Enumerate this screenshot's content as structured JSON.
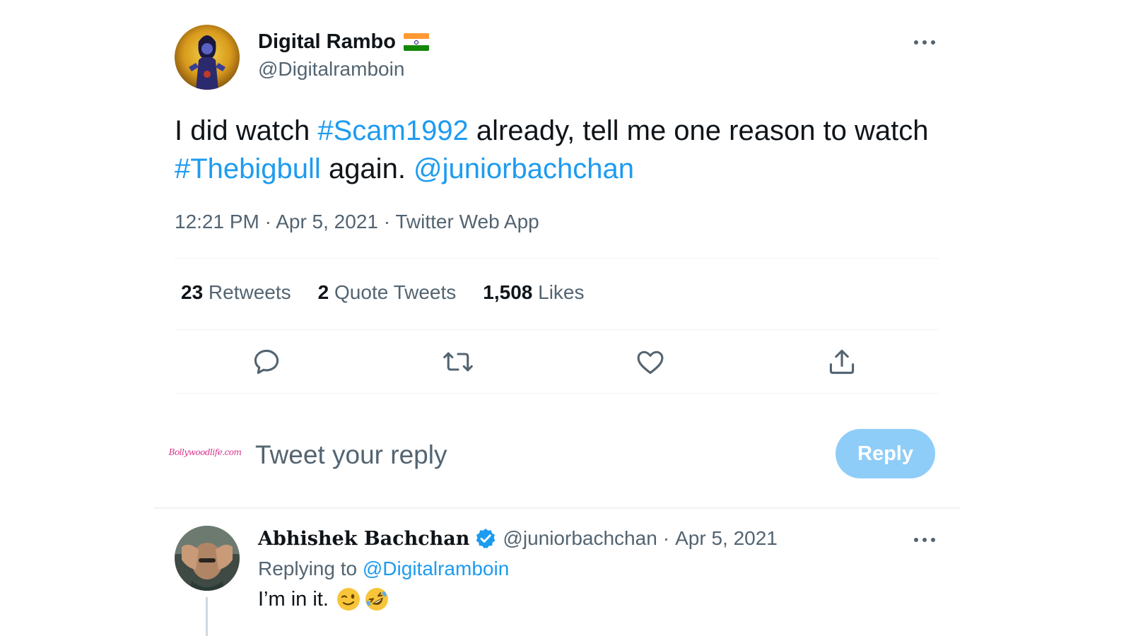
{
  "tweet": {
    "author": {
      "name": "Digital Rambo",
      "handle": "@Digitalramboin",
      "flag_icon": "india-flag-icon"
    },
    "text": {
      "part1": "I did watch ",
      "hashtag1": "#Scam1992",
      "part2": " already, tell me one reason to watch ",
      "hashtag2": "#Thebigbull",
      "part3": " again. ",
      "mention": "@juniorbachchan"
    },
    "meta": {
      "time": "12:21 PM",
      "sep1": " · ",
      "date": "Apr 5, 2021",
      "sep2": " · ",
      "source": "Twitter Web App"
    },
    "stats": {
      "retweets": {
        "count": "23",
        "label": " Retweets"
      },
      "quotes": {
        "count": "2",
        "label": " Quote Tweets"
      },
      "likes": {
        "count": "1,508",
        "label": " Likes"
      }
    },
    "actions": [
      "reply-icon",
      "retweet-icon",
      "like-icon",
      "share-icon"
    ]
  },
  "compose": {
    "avatar_text": "Bollywoodlife.com",
    "placeholder": "Tweet your reply",
    "button_label": "Reply"
  },
  "reply": {
    "name": "Abhishek Bachchan",
    "handle": "@juniorbachchan",
    "dot": "·",
    "date": "Apr 5, 2021",
    "replying_prefix": "Replying to ",
    "replying_to": "@Digitalramboin",
    "text": "I’m in it.",
    "emojis": [
      "winking-face-emoji",
      "rolling-on-floor-laughing-emoji"
    ]
  },
  "colors": {
    "link": "#1d9bf0",
    "secondary_text": "#536471",
    "reply_button_bg": "#8ecdf8"
  }
}
